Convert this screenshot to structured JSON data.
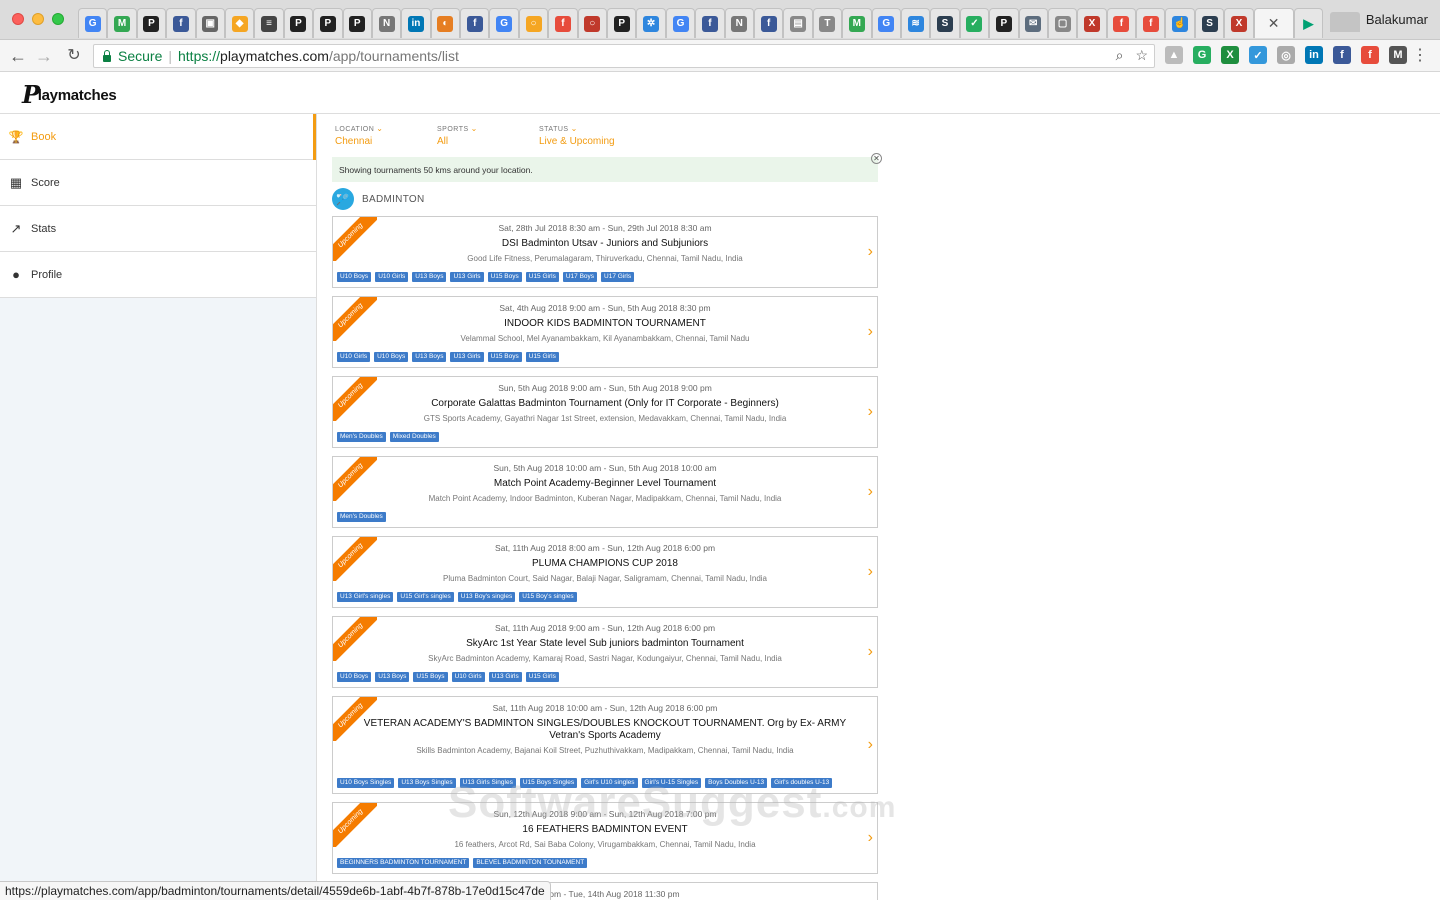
{
  "browser": {
    "user_name": "Balakumar",
    "active_tab_close": "✕",
    "secure_label": "Secure",
    "url_scheme": "https://",
    "url_host": "playmatches.com",
    "url_path": "/app/tournaments/list",
    "status_url": "https://playmatches.com/app/badminton/tournaments/detail/4559de6b-1abf-4b7f-878b-17e0d15c47de",
    "tabs": [
      {
        "glyph": "G",
        "color": "#4285f4"
      },
      {
        "glyph": "M",
        "color": "#34a853"
      },
      {
        "glyph": "P",
        "color": "#222"
      },
      {
        "glyph": "f",
        "color": "#3b5998"
      },
      {
        "glyph": "▣",
        "color": "#666"
      },
      {
        "glyph": "◆",
        "color": "#f5a623"
      },
      {
        "glyph": "≡",
        "color": "#444"
      },
      {
        "glyph": "P",
        "color": "#222"
      },
      {
        "glyph": "P",
        "color": "#222"
      },
      {
        "glyph": "P",
        "color": "#222"
      },
      {
        "glyph": "N",
        "color": "#777"
      },
      {
        "glyph": "in",
        "color": "#0077b5"
      },
      {
        "glyph": "◐",
        "color": "#e67e22"
      },
      {
        "glyph": "f",
        "color": "#3b5998"
      },
      {
        "glyph": "G",
        "color": "#4285f4"
      },
      {
        "glyph": "○",
        "color": "#f5a623"
      },
      {
        "glyph": "f",
        "color": "#e74c3c"
      },
      {
        "glyph": "○",
        "color": "#c0392b"
      },
      {
        "glyph": "P",
        "color": "#222"
      },
      {
        "glyph": "✲",
        "color": "#2e86de"
      },
      {
        "glyph": "G",
        "color": "#4285f4"
      },
      {
        "glyph": "f",
        "color": "#3b5998"
      },
      {
        "glyph": "N",
        "color": "#777"
      },
      {
        "glyph": "f",
        "color": "#3b5998"
      },
      {
        "glyph": "▤",
        "color": "#888"
      },
      {
        "glyph": "T",
        "color": "#888"
      },
      {
        "glyph": "M",
        "color": "#34a853"
      },
      {
        "glyph": "G",
        "color": "#4285f4"
      },
      {
        "glyph": "≋",
        "color": "#2e86de"
      },
      {
        "glyph": "S",
        "color": "#2c3e50"
      },
      {
        "glyph": "✓",
        "color": "#27ae60"
      },
      {
        "glyph": "P",
        "color": "#222"
      },
      {
        "glyph": "✉",
        "color": "#5d6d7e"
      },
      {
        "glyph": "▢",
        "color": "#888"
      },
      {
        "glyph": "X",
        "color": "#c0392b"
      },
      {
        "glyph": "f",
        "color": "#e74c3c"
      },
      {
        "glyph": "f",
        "color": "#e74c3c"
      },
      {
        "glyph": "☝",
        "color": "#2e86de"
      },
      {
        "glyph": "S",
        "color": "#2c3e50"
      },
      {
        "glyph": "X",
        "color": "#c0392b"
      }
    ],
    "last_tab_glyph": "▶",
    "extensions": [
      {
        "glyph": "▲",
        "color": "#bbb"
      },
      {
        "glyph": "G",
        "color": "#27ae60"
      },
      {
        "glyph": "X",
        "color": "#1e8e3e"
      },
      {
        "glyph": "✓",
        "color": "#3498db"
      },
      {
        "glyph": "◎",
        "color": "#aaa"
      },
      {
        "glyph": "in",
        "color": "#0077b5"
      },
      {
        "glyph": "f",
        "color": "#3b5998"
      },
      {
        "glyph": "f",
        "color": "#e74c3c"
      },
      {
        "glyph": "M",
        "color": "#555"
      }
    ]
  },
  "app": {
    "logo_initial": "P",
    "logo_text": "laymatches",
    "sidebar": [
      {
        "label": "Book",
        "icon": "🏆"
      },
      {
        "label": "Score",
        "icon": "▦"
      },
      {
        "label": "Stats",
        "icon": "↗"
      },
      {
        "label": "Profile",
        "icon": "●"
      }
    ],
    "filters": [
      {
        "label": "LOCATION",
        "value": "Chennai"
      },
      {
        "label": "SPORTS",
        "value": "All"
      },
      {
        "label": "STATUS",
        "value": "Live & Upcoming"
      }
    ],
    "notice": "Showing tournaments 50 kms around your location.",
    "section_title": "BADMINTON",
    "ribbon_label": "Upcoming",
    "watermark": "SoftwareSuggest",
    "watermark_suffix": ".com"
  },
  "tournaments": [
    {
      "date": "Sat, 28th Jul 2018 8:30 am - Sun, 29th Jul 2018 8:30 am",
      "title": "DSI Badminton Utsav - Juniors and Subjuniors",
      "venue": "Good Life Fitness, Perumalagaram, Thiruverkadu, Chennai, Tamil Nadu, India",
      "tags": [
        "U10 Boys",
        "U10 Girls",
        "U13 Boys",
        "U13 Girls",
        "U15 Boys",
        "U15 Girls",
        "U17 Boys",
        "U17 Girls"
      ]
    },
    {
      "date": "Sat, 4th Aug 2018 9:00 am - Sun, 5th Aug 2018 8:30 pm",
      "title": "INDOOR KIDS BADMINTON TOURNAMENT",
      "venue": "Velammal School, Mel Ayanambakkam, Kil Ayanambakkam, Chennai, Tamil Nadu",
      "tags": [
        "U10 Girls",
        "U10 Boys",
        "U13 Boys",
        "U13 Girls",
        "U15 Boys",
        "U15 Girls"
      ]
    },
    {
      "date": "Sun, 5th Aug 2018 9:00 am - Sun, 5th Aug 2018 9:00 pm",
      "title": "Corporate Galattas Badminton Tournament (Only for IT Corporate - Beginners)",
      "venue": "GTS Sports Academy, Gayathri Nagar 1st Street, extension, Medavakkam, Chennai, Tamil Nadu, India",
      "tags": [
        "Men's Doubles",
        "Mixed Doubles"
      ]
    },
    {
      "date": "Sun, 5th Aug 2018 10:00 am - Sun, 5th Aug 2018 10:00 am",
      "title": "Match Point Academy-Beginner Level Tournament",
      "venue": "Match Point Academy, Indoor Badminton, Kuberan Nagar, Madipakkam, Chennai, Tamil Nadu, India",
      "tags": [
        "Men's Doubles"
      ]
    },
    {
      "date": "Sat, 11th Aug 2018 8:00 am - Sun, 12th Aug 2018 6:00 pm",
      "title": "PLUMA CHAMPIONS CUP 2018",
      "venue": "Pluma Badminton Court, Said Nagar, Balaji Nagar, Saligramam, Chennai, Tamil Nadu, India",
      "tags": [
        "U13 Girl's singles",
        "U15 Girl's singles",
        "U13 Boy's singles",
        "U15 Boy's singles"
      ]
    },
    {
      "date": "Sat, 11th Aug 2018 9:00 am - Sun, 12th Aug 2018 6:00 pm",
      "title": "SkyArc 1st Year State level Sub juniors badminton Tournament",
      "venue": "SkyArc Badminton Academy, Kamaraj Road, Sastri Nagar, Kodungaiyur, Chennai, Tamil Nadu, India",
      "tags": [
        "U10 Boys",
        "U13 Boys",
        "U15 Boys",
        "U10 Girls",
        "U13 Girls",
        "U15 Girls"
      ]
    },
    {
      "date": "Sat, 11th Aug 2018 10:00 am - Sun, 12th Aug 2018 6:00 pm",
      "title": "VETERAN ACADEMY'S BADMINTON SINGLES/DOUBLES KNOCKOUT TOURNAMENT. Org by Ex- ARMY Vetran's Sports Academy",
      "venue": "Skills Badminton Academy, Bajanai Koil Street, Puzhuthivakkam, Madipakkam, Chennai, Tamil Nadu, India",
      "tags": [
        "U10 Boys Singles",
        "U13 Boys Singles",
        "U13 Girls Singles",
        "U15 Boys Singles",
        "Girl's U10 singles",
        "Girl's U-15 Singles",
        "Boys Doubles U-13",
        "Girl's doubles U-13"
      ]
    },
    {
      "date": "Sun, 12th Aug 2018 9:00 am - Sun, 12th Aug 2018 7:00 pm",
      "title": "16 FEATHERS BADMINTON EVENT",
      "venue": "16 feathers, Arcot Rd, Sai Baba Colony, Virugambakkam, Chennai, Tamil Nadu, India",
      "tags": [
        "BEGINNERS BADMINTON TOURNAMENT",
        "BLEVEL BADMINTON TOUNAMENT"
      ]
    }
  ],
  "partial_card_date": "6:00 pm - Tue, 14th Aug 2018 11:30 pm"
}
